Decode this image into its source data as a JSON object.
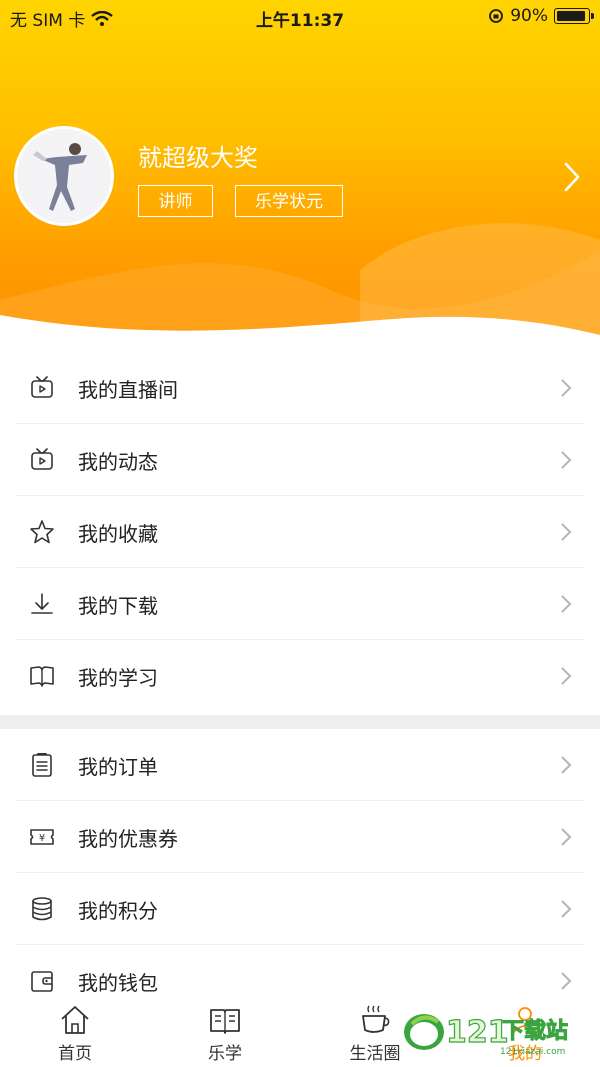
{
  "status_bar": {
    "carrier": "无 SIM 卡",
    "time": "上午11:37",
    "battery": "90%"
  },
  "profile": {
    "username": "就超级大奖",
    "tags": [
      "讲师",
      "乐学状元"
    ]
  },
  "menu_group_1": [
    {
      "label": "我的直播间",
      "icon": "live-tv-icon"
    },
    {
      "label": "我的动态",
      "icon": "tv-icon"
    },
    {
      "label": "我的收藏",
      "icon": "star-icon"
    },
    {
      "label": "我的下载",
      "icon": "download-icon"
    },
    {
      "label": "我的学习",
      "icon": "book-open-icon"
    }
  ],
  "menu_group_2": [
    {
      "label": "我的订单",
      "icon": "clipboard-icon"
    },
    {
      "label": "我的优惠券",
      "icon": "coupon-icon"
    },
    {
      "label": "我的积分",
      "icon": "database-icon"
    },
    {
      "label": "我的钱包",
      "icon": "wallet-icon"
    }
  ],
  "tabbar": {
    "tabs": [
      "首页",
      "乐学",
      "生活圈",
      "我的"
    ],
    "active_index": 3
  },
  "watermark": {
    "text": "121下载站",
    "sub": "121xiazai.com"
  },
  "colors": {
    "header_top": "#ffd400",
    "header_bottom": "#ff8c00",
    "accent": "#ff8c00"
  }
}
